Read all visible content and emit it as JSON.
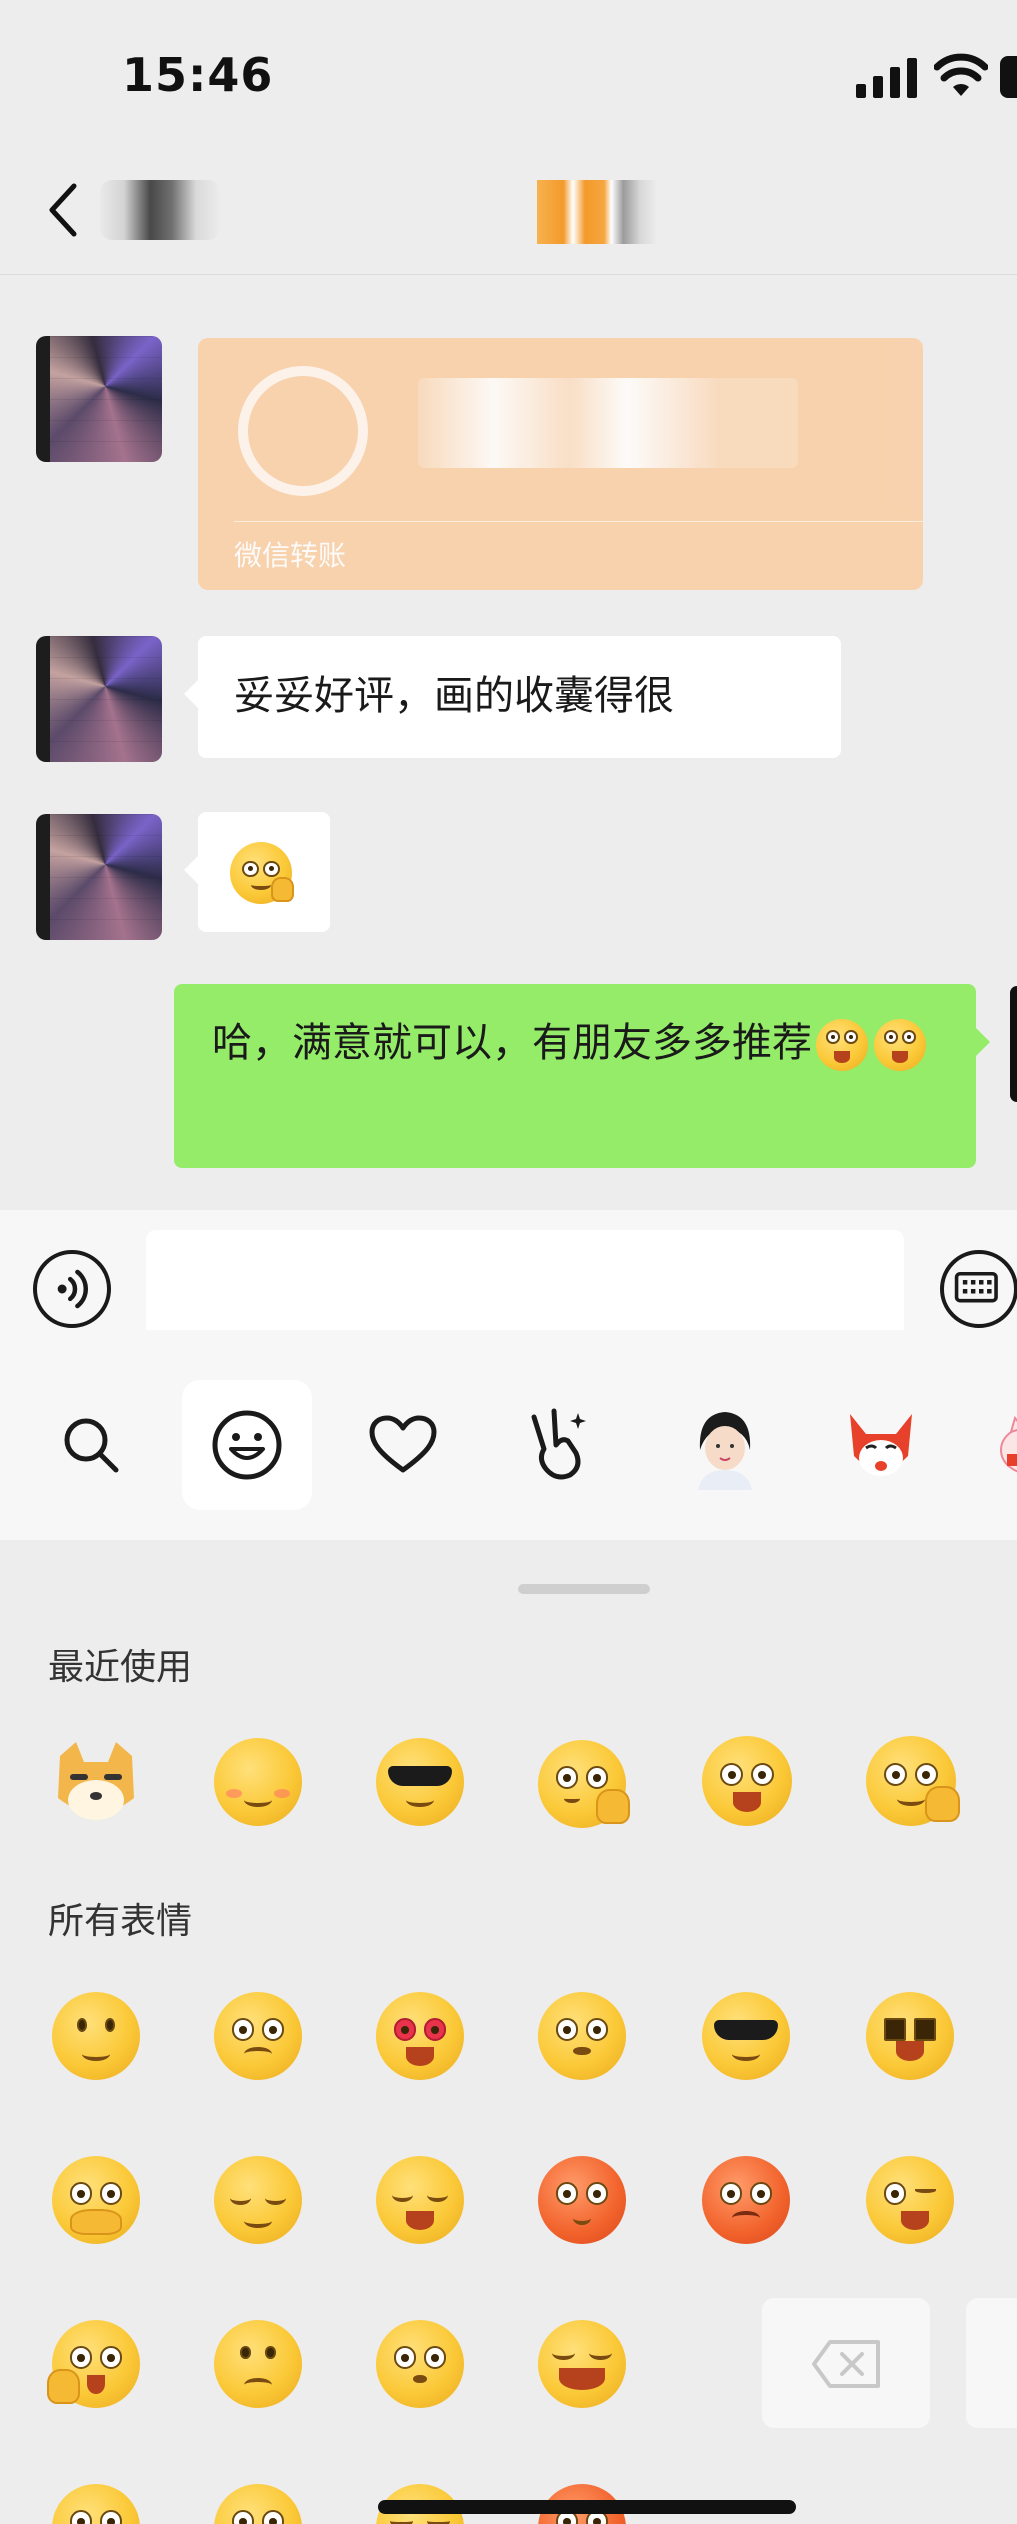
{
  "status_bar": {
    "time": "15:46"
  },
  "messages": [
    {
      "type": "transfer",
      "direction": "in",
      "label": "微信转账"
    },
    {
      "type": "text",
      "direction": "in",
      "text": "妥妥好评，画的收囊得很"
    },
    {
      "type": "emoji",
      "direction": "in",
      "emoji": "salute-emoji"
    },
    {
      "type": "text",
      "direction": "out",
      "text": "哈，满意就可以，有朋友多多推荐",
      "trailing_emojis": [
        "tongue-out-emoji",
        "tongue-out-emoji"
      ]
    }
  ],
  "input_bar": {
    "placeholder": ""
  },
  "sticker_tabs": [
    "search-icon",
    "emoji-icon",
    "heart-icon",
    "victory-hand-icon",
    "sticker-pack-1",
    "sticker-pack-2",
    "sticker-pack-3"
  ],
  "emoji_panel": {
    "recent_title": "最近使用",
    "all_title": "所有表情",
    "recent": [
      "doge",
      "blush",
      "cool",
      "confused",
      "wow",
      "salute"
    ],
    "all_rows": [
      [
        "smile",
        "worried",
        "heart-eyes",
        "frown",
        "cool",
        "cry"
      ],
      [
        "shush",
        "sleepy",
        "tears",
        "embarrassed",
        "angry",
        "wink"
      ],
      [
        "surprised",
        "sad",
        "awkward",
        "laugh-cry"
      ],
      [
        "shocked",
        "pensive",
        "bored",
        "sweat-angry"
      ]
    ]
  },
  "colors": {
    "outgoing_bubble": "#95ec69",
    "incoming_bubble": "#ffffff",
    "transfer_card": "#f9cfa8",
    "background": "#ededed"
  }
}
